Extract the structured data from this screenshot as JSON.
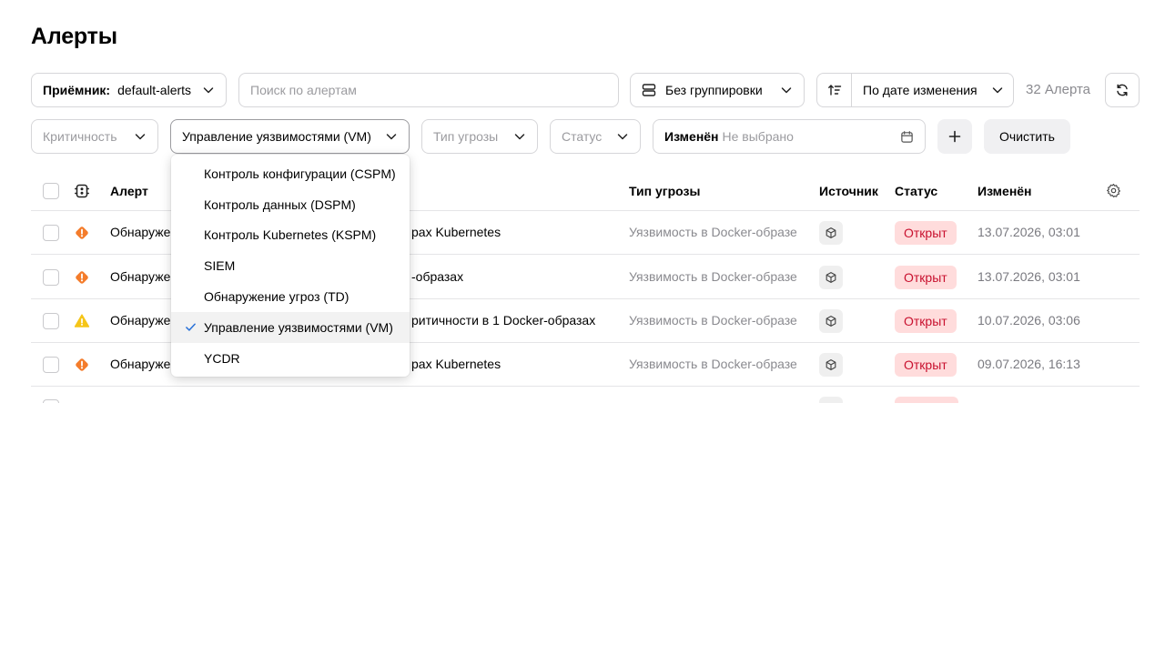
{
  "page": {
    "title": "Алерты"
  },
  "toolbar": {
    "receiver_label": "Приёмник:",
    "receiver_value": "default-alerts",
    "search_placeholder": "Поиск по алертам",
    "grouping_label": "Без группировки",
    "sort_label": "По дате изменения",
    "count_label": "32 Алерта"
  },
  "filters": {
    "criticality": "Критичность",
    "module": "Управление уязвимостями (VM)",
    "threat_type": "Тип угрозы",
    "status": "Статус",
    "changed_label": "Изменён",
    "changed_value": "Не выбрано",
    "clear_label": "Очистить"
  },
  "table": {
    "headers": {
      "alert": "Алерт",
      "threat": "Тип угрозы",
      "source": "Источник",
      "status": "Статус",
      "changed": "Изменён"
    },
    "rows": [
      {
        "severity": "high",
        "alert_start": "Обнаруже",
        "alert_end": "рах Kubernetes",
        "threat": "Уязвимость в Docker-образе",
        "status": "Открыт",
        "changed": "13.07.2026, 03:01"
      },
      {
        "severity": "high",
        "alert_start": "Обнаруже",
        "alert_end": "-образах",
        "threat": "Уязвимость в Docker-образе",
        "status": "Открыт",
        "changed": "13.07.2026, 03:01"
      },
      {
        "severity": "medium",
        "alert_start": "Обнаруже",
        "alert_end": "ритичности в 1 Docker-образах",
        "threat": "Уязвимость в Docker-образе",
        "status": "Открыт",
        "changed": "10.07.2026, 03:06"
      },
      {
        "severity": "high",
        "alert_start": "Обнаруже",
        "alert_end": "рах Kubernetes",
        "threat": "Уязвимость в Docker-образе",
        "status": "Открыт",
        "changed": "09.07.2026, 16:13"
      }
    ]
  },
  "dropdown": {
    "items": [
      "Контроль конфигурации (CSPM)",
      "Контроль данных (DSPM)",
      "Контроль Kubernetes (KSPM)",
      "SIEM",
      "Обнаружение угроз (TD)",
      "Управление уязвимостями (VM)",
      "YCDR"
    ],
    "selected_index": 5
  },
  "colors": {
    "severity_high": "#f47c2b",
    "severity_medium": "#f5c518",
    "status_bg": "#ffdcdc",
    "status_text": "#c8102e",
    "check_accent": "#2a72d8"
  }
}
